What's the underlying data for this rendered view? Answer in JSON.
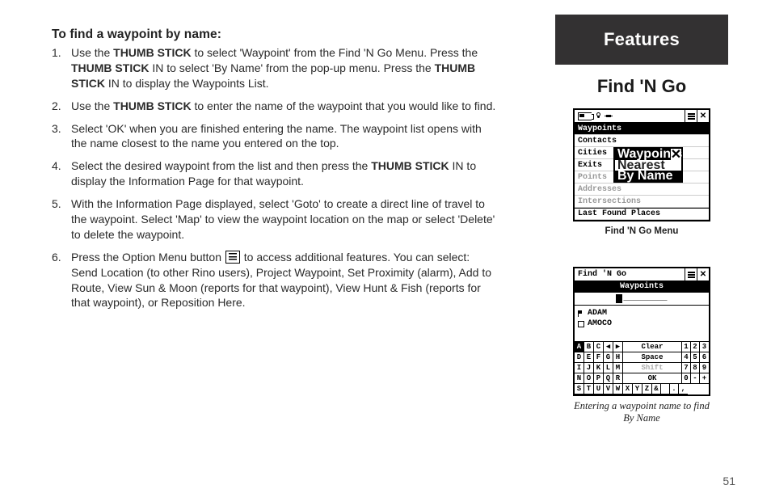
{
  "page_number": "51",
  "heading": "To find a waypoint by name:",
  "steps": [
    [
      {
        "t": "Use the "
      },
      {
        "t": "THUMB STICK",
        "b": true
      },
      {
        "t": " to select 'Waypoint' from the Find 'N Go Menu.  Press the "
      },
      {
        "t": "THUMB STICK",
        "b": true
      },
      {
        "t": " IN to select 'By Name' from the pop-up menu.  Press the "
      },
      {
        "t": "THUMB STICK",
        "b": true
      },
      {
        "t": " IN to display the Waypoints List."
      }
    ],
    [
      {
        "t": "Use the "
      },
      {
        "t": "THUMB STICK",
        "b": true
      },
      {
        "t": " to enter the name of the waypoint that you would like to find."
      }
    ],
    [
      {
        "t": "Select 'OK' when you are finished entering the name.  The waypoint list opens with the name closest to the name you entered on the top."
      }
    ],
    [
      {
        "t": "Select the desired waypoint from the list and then press the "
      },
      {
        "t": "THUMB STICK",
        "b": true
      },
      {
        "t": " IN to display the Information Page for that waypoint."
      }
    ],
    [
      {
        "t": "With the Information Page displayed, select 'Goto' to create a direct line of travel to the waypoint.  Select 'Map' to view the waypoint location on the map or select 'Delete' to delete the waypoint."
      }
    ],
    [
      {
        "t": "Press the Option Menu button "
      },
      {
        "icon": "option-menu"
      },
      {
        "t": " to access additional features.  You can select: Send Location (to other Rino users), Project Waypoint, Set Proximity (alarm), Add to Route, View Sun & Moon (reports for that waypoint), View Hunt & Fish (reports for that waypoint), or Reposition Here."
      }
    ]
  ],
  "tab": "Features",
  "section_title": "Find 'N Go",
  "screen1": {
    "rows": [
      "Waypoints",
      "Contacts",
      "Cities",
      "Exits",
      "Points",
      "Addresses",
      "Intersections"
    ],
    "last": "Last Found Places",
    "popup_title": "Waypoints",
    "popup_items": [
      "Nearest",
      "By Name"
    ],
    "caption": "Find 'N Go Menu"
  },
  "screen2": {
    "title": "Find 'N Go",
    "header": "Waypoints",
    "blanks": "_________",
    "list": [
      "ADAM",
      "AMOCO"
    ],
    "kb": [
      {
        "letters": [
          "A",
          "B",
          "C",
          "◀",
          "▶"
        ],
        "word": "Clear",
        "nums": [
          "1",
          "2",
          "3"
        ]
      },
      {
        "letters": [
          "D",
          "E",
          "F",
          "G",
          "H"
        ],
        "word": "Space",
        "nums": [
          "4",
          "5",
          "6"
        ]
      },
      {
        "letters": [
          "I",
          "J",
          "K",
          "L",
          "M"
        ],
        "word": "Shift",
        "dim": true,
        "nums": [
          "7",
          "8",
          "9"
        ]
      },
      {
        "letters": [
          "N",
          "O",
          "P",
          "Q",
          "R"
        ],
        "word": "OK",
        "nums": [
          "0",
          "-",
          "+"
        ]
      },
      {
        "letters": [
          "S",
          "T",
          "U",
          "V",
          "W",
          "X",
          "Y",
          "Z"
        ],
        "tail": [
          "&",
          " ",
          ".",
          ","
        ]
      }
    ],
    "caption": "Entering a waypoint name to find By Name"
  }
}
